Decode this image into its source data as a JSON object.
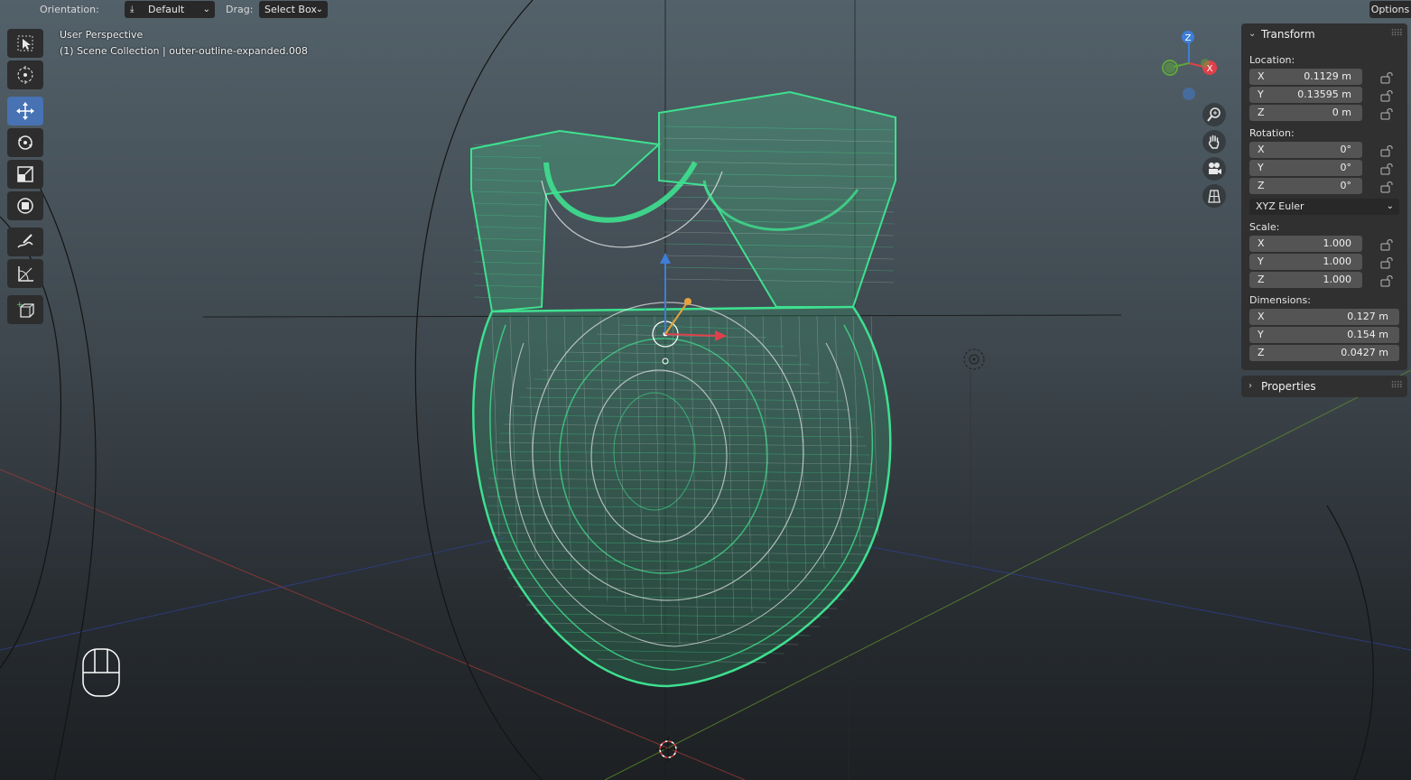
{
  "header": {
    "orientation_label": "Orientation:",
    "orientation_value": "Default",
    "drag_label": "Drag:",
    "drag_value": "Select Box",
    "options_label": "Options"
  },
  "viewport": {
    "perspective": "User Perspective",
    "collection": "(1) Scene Collection | outer-outline-expanded.008"
  },
  "toolbar": {
    "tools": [
      "select-box",
      "cursor",
      "move",
      "rotate",
      "scale",
      "transform",
      "annotate",
      "measure",
      "add-cube"
    ],
    "active_tool": "move"
  },
  "gizmo": {
    "z_label": "Z",
    "x_label": "X",
    "colors": {
      "x": "#e0404a",
      "y": "#5fa53a",
      "z": "#3d7ed8"
    }
  },
  "nav_buttons": [
    "zoom-icon",
    "hand-icon",
    "camera-icon",
    "grid-icon"
  ],
  "transform": {
    "title": "Transform",
    "location_label": "Location:",
    "location": [
      {
        "axis": "X",
        "value": "0.1129 m"
      },
      {
        "axis": "Y",
        "value": "0.13595 m"
      },
      {
        "axis": "Z",
        "value": "0 m"
      }
    ],
    "rotation_label": "Rotation:",
    "rotation": [
      {
        "axis": "X",
        "value": "0°"
      },
      {
        "axis": "Y",
        "value": "0°"
      },
      {
        "axis": "Z",
        "value": "0°"
      }
    ],
    "rotation_mode": "XYZ Euler",
    "scale_label": "Scale:",
    "scale": [
      {
        "axis": "X",
        "value": "1.000"
      },
      {
        "axis": "Y",
        "value": "1.000"
      },
      {
        "axis": "Z",
        "value": "1.000"
      }
    ],
    "dimensions_label": "Dimensions:",
    "dimensions": [
      {
        "axis": "X",
        "value": "0.127 m"
      },
      {
        "axis": "Y",
        "value": "0.154 m"
      },
      {
        "axis": "Z",
        "value": "0.0427 m"
      }
    ]
  },
  "properties": {
    "title": "Properties"
  },
  "colors": {
    "wire_selected": "#3ee08f",
    "wire_inner": "#e8e8e8",
    "active_tool": "#4772b3",
    "panel_bg": "#303030"
  }
}
